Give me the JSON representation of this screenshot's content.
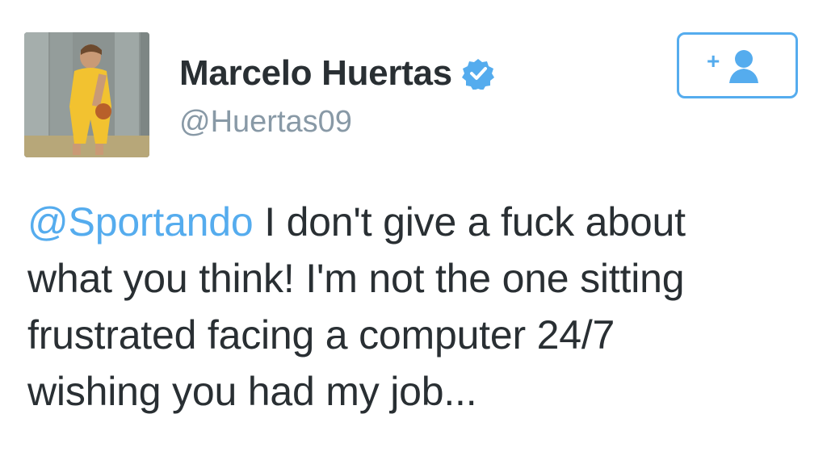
{
  "user": {
    "display_name": "Marcelo Huertas",
    "handle": "@Huertas09",
    "verified": true
  },
  "follow_button": {
    "icon": "add-user-icon",
    "symbol": "+"
  },
  "tweet": {
    "mention": "@Sportando",
    "text_lines": [
      " I don't give a fuck about",
      "what you think! I'm not the one sitting",
      "frustrated facing a computer 24/7",
      "wishing you had my job..."
    ]
  },
  "colors": {
    "accent": "#55acee",
    "text": "#292f33",
    "muted": "#8899a6"
  }
}
